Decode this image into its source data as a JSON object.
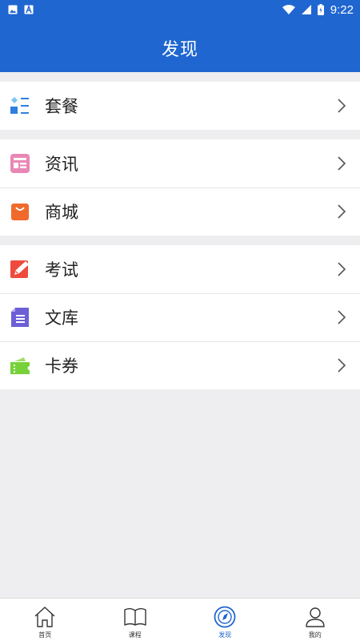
{
  "status": {
    "time": "9:22"
  },
  "header": {
    "title": "发现"
  },
  "groups": [
    {
      "items": [
        {
          "label": "套餐",
          "icon": "package-list-icon",
          "color": "#3b8be6"
        }
      ]
    },
    {
      "items": [
        {
          "label": "资讯",
          "icon": "news-icon",
          "color": "#e87bb0"
        },
        {
          "label": "商城",
          "icon": "shopping-bag-icon",
          "color": "#f06a2c"
        }
      ]
    },
    {
      "items": [
        {
          "label": "考试",
          "icon": "exam-edit-icon",
          "color": "#ee4b3e"
        },
        {
          "label": "文库",
          "icon": "document-library-icon",
          "color": "#6d5fd6"
        },
        {
          "label": "卡券",
          "icon": "ticket-icon",
          "color": "#77d13a"
        }
      ]
    }
  ],
  "bottom_nav": [
    {
      "label": "首页",
      "icon": "home-icon"
    },
    {
      "label": "课程",
      "icon": "book-icon"
    },
    {
      "label": "发现",
      "icon": "compass-icon",
      "active": true
    },
    {
      "label": "我的",
      "icon": "user-icon"
    }
  ],
  "colors": {
    "primary": "#1f66d1",
    "background": "#eeeef0"
  }
}
